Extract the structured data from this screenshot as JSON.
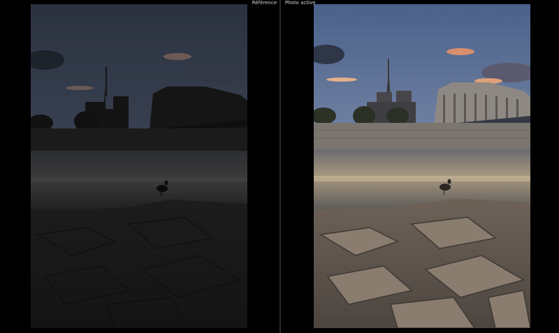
{
  "panes": {
    "reference": {
      "label": "Référence"
    },
    "active": {
      "label": "Photo active"
    }
  },
  "colors": {
    "background": "#000000",
    "label_text": "#d8d8d8"
  },
  "photo": {
    "subject": "Seine riverbank at dusk with cathedral silhouette and duck",
    "reference_edit": "dark, underexposed",
    "active_edit": "brightened, warm"
  }
}
